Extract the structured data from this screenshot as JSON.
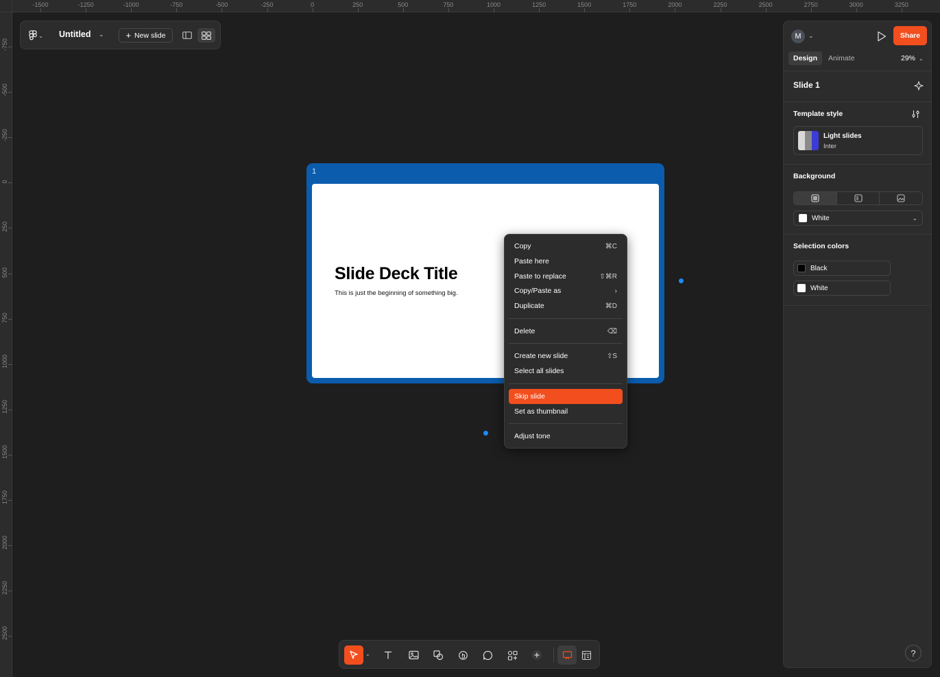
{
  "rulers": {
    "top": [
      "-1500",
      "-1250",
      "-1000",
      "-750",
      "-500",
      "-250",
      "0",
      "250",
      "500",
      "750",
      "1000",
      "1250",
      "1500",
      "1750",
      "2000",
      "2250",
      "2500",
      "2750",
      "3000",
      "3250"
    ],
    "left": [
      "-750",
      "-500",
      "-250",
      "0",
      "250",
      "500",
      "750",
      "1000",
      "1250",
      "1500",
      "1750",
      "2000",
      "2250",
      "2500"
    ]
  },
  "toolbar": {
    "doc_title": "Untitled",
    "new_slide_label": "New slide"
  },
  "slide": {
    "number": "1",
    "title": "Slide Deck Title",
    "subtitle": "This is just the beginning of something big."
  },
  "context_menu": {
    "items": [
      {
        "label": "Copy",
        "shortcut": "⌘C"
      },
      {
        "label": "Paste here",
        "shortcut": ""
      },
      {
        "label": "Paste to replace",
        "shortcut": "⇧⌘R"
      },
      {
        "label": "Copy/Paste as",
        "shortcut": "›"
      },
      {
        "label": "Duplicate",
        "shortcut": "⌘D"
      },
      {
        "label": "Delete",
        "shortcut": "⌫"
      },
      {
        "label": "Create new slide",
        "shortcut": "⇧S"
      },
      {
        "label": "Select all slides",
        "shortcut": ""
      },
      {
        "label": "Skip slide",
        "shortcut": ""
      },
      {
        "label": "Set as thumbnail",
        "shortcut": ""
      },
      {
        "label": "Adjust tone",
        "shortcut": ""
      }
    ]
  },
  "right_panel": {
    "avatar_initial": "M",
    "share_label": "Share",
    "tabs": [
      {
        "label": "Design"
      },
      {
        "label": "Animate"
      }
    ],
    "zoom": "29%",
    "slide_name": "Slide 1",
    "template_style_title": "Template style",
    "template": {
      "name": "Light slides",
      "font": "Inter"
    },
    "background_title": "Background",
    "background_color": "White",
    "selection_colors_title": "Selection colors",
    "selection_colors": [
      {
        "name": "Black",
        "hex": "#000000"
      },
      {
        "name": "White",
        "hex": "#FFFFFF"
      }
    ],
    "help_label": "?"
  },
  "colors": {
    "accent": "#F24E1E",
    "selection_blue": "#0B5CAD",
    "canvas": "#1E1E1E",
    "panel": "#2C2C2C"
  }
}
